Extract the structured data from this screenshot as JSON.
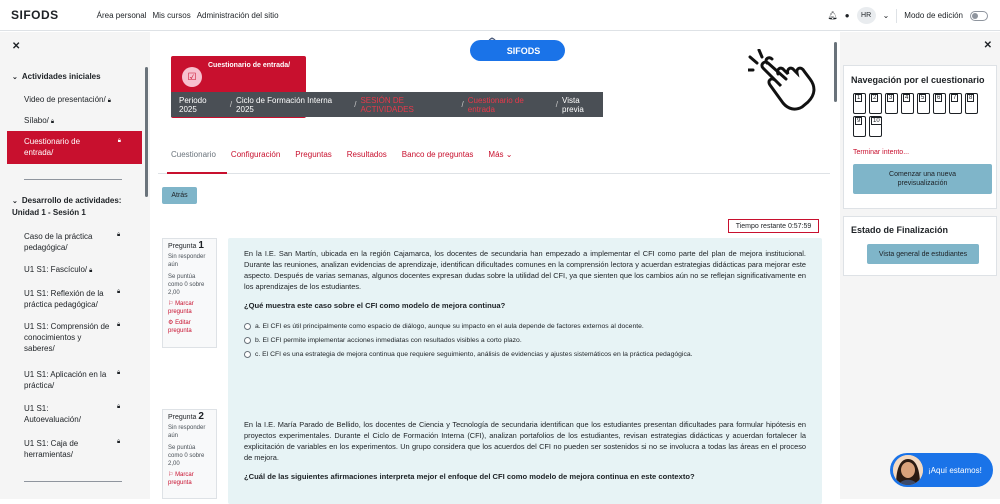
{
  "topbar": {
    "brand": "SIFODS",
    "nav": [
      "Área personal",
      "Mis cursos",
      "Administración del sitio"
    ],
    "user_initials": "HR",
    "edit_mode_label": "Modo de edición"
  },
  "left_drawer": {
    "section1": "Actividades iniciales",
    "items1": [
      {
        "label": "Video de presentación/"
      },
      {
        "label": "Sílabo/"
      }
    ],
    "active_item": "Cuestionario de entrada/",
    "section2": "Desarrollo de actividades: Unidad 1 - Sesión 1",
    "items2": [
      {
        "label": "Caso de la práctica pedagógica/"
      },
      {
        "label": "U1 S1: Fascículo/"
      },
      {
        "label": "U1 S1: Reflexión de la práctica pedagógica/"
      },
      {
        "label": "U1 S1: Comprensión de conocimientos y saberes/"
      },
      {
        "label": "U1 S1: Aplicación en la práctica/"
      },
      {
        "label": "U1 S1: Autoevaluación/"
      },
      {
        "label": "U1 S1: Caja de herramientas/"
      }
    ]
  },
  "header": {
    "logo_text": "SIFODS",
    "quiz_title": "Cuestionario de entrada/",
    "breadcrumb": [
      "Periodo 2025",
      "Ciclo de Formación Interna 2025",
      "SESIÓN DE ACTIVIDADES",
      "Cuestionario de entrada",
      "Vista previa"
    ]
  },
  "tabs": [
    "Cuestionario",
    "Configuración",
    "Preguntas",
    "Resultados",
    "Banco de preguntas",
    "Más"
  ],
  "back_label": "Atrás",
  "timer": "Tiempo restante 0:57:59",
  "questions": [
    {
      "label": "Pregunta",
      "number": "1",
      "status": "Sin responder aún",
      "score": "Se puntúa como 0 sobre 2,00",
      "flag": "Marcar pregunta",
      "edit": "Editar pregunta",
      "text": "En la I.E. San Martín, ubicada en la región Cajamarca, los docentes de secundaria han empezado a implementar el CFI como parte del plan de mejora institucional. Durante las reuniones, analizan evidencias de aprendizaje, identifican dificultades comunes en la comprensión lectora y acuerdan estrategias didácticas para mejorar este aspecto. Después de varias semanas, algunos docentes expresan dudas sobre la utilidad del CFI, ya que sienten que los cambios aún no se reflejan significativamente en los aprendizajes de los estudiantes.",
      "prompt": "¿Qué muestra este caso sobre el CFI como modelo de mejora continua?",
      "options": [
        "a.  El CFI es útil principalmente como espacio de diálogo, aunque su impacto en el aula depende de factores externos al docente.",
        "b.  El CFI permite implementar acciones inmediatas con resultados visibles a corto plazo.",
        "c.  El CFI es una estrategia de mejora continua que requiere seguimiento, análisis de evidencias y ajustes sistemáticos en la práctica pedagógica."
      ]
    },
    {
      "label": "Pregunta",
      "number": "2",
      "status": "Sin responder aún",
      "score": "Se puntúa como 0 sobre 2,00",
      "flag": "Marcar pregunta",
      "text": "En la I.E. María Parado de Bellido, los docentes de Ciencia y Tecnología de secundaria identifican que los estudiantes presentan dificultades para formular hipótesis en proyectos experimentales. Durante el Ciclo de Formación Interna (CFI), analizan portafolios de los estudiantes, revisan estrategias didácticas y acuerdan fortalecer la explicitación de variables en los experimentos. Un grupo considera que los acuerdos del CFI no pueden ser sostenidos si no se involucra a todas las áreas en el proceso de mejora.",
      "prompt": "¿Cuál de las siguientes afirmaciones interpreta mejor el enfoque del CFI como modelo de mejora continua en este contexto?"
    }
  ],
  "right_drawer": {
    "nav_title": "Navegación por el cuestionario",
    "nav_numbers": [
      "1",
      "2",
      "3",
      "4",
      "5",
      "6",
      "7",
      "8",
      "9",
      "10"
    ],
    "finish_link": "Terminar intento...",
    "preview_button": "Comenzar una nueva previsualización",
    "status_title": "Estado de Finalización",
    "overview_button": "Vista general de estudiantes"
  },
  "chat": {
    "label": "¡Aquí estamos!"
  }
}
